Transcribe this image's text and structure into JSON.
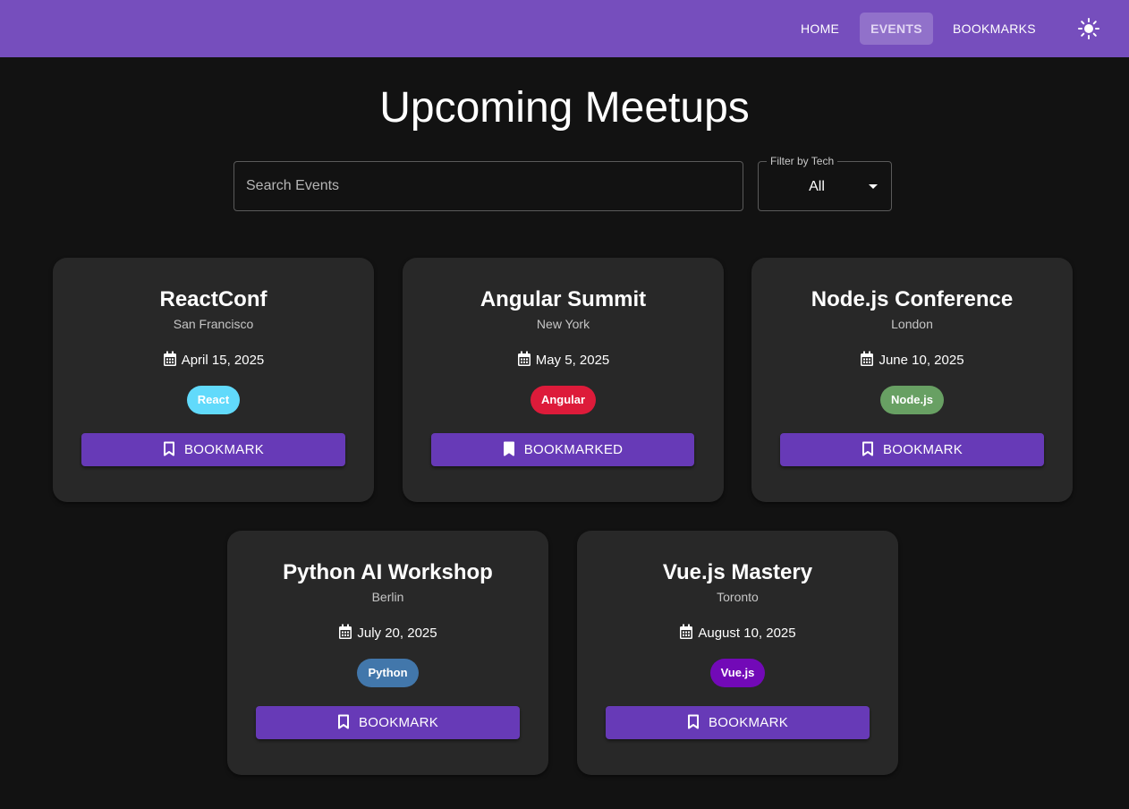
{
  "nav": {
    "home": "HOME",
    "events": "EVENTS",
    "bookmarks": "BOOKMARKS",
    "theme_icon": "sun-icon"
  },
  "page": {
    "title": "Upcoming Meetups"
  },
  "search": {
    "placeholder": "Search Events",
    "value": ""
  },
  "filter": {
    "label": "Filter by Tech",
    "selected": "All"
  },
  "colors": {
    "appbar": "#764ebd",
    "background": "#121212",
    "card": "#282828",
    "button": "#673ab7"
  },
  "events": [
    {
      "title": "ReactConf",
      "city": "San Francisco",
      "date": "April 15, 2025",
      "tag": "React",
      "tag_color": "#61dafb",
      "button": "BOOKMARK",
      "bookmarked": false
    },
    {
      "title": "Angular Summit",
      "city": "New York",
      "date": "May 5, 2025",
      "tag": "Angular",
      "tag_color": "#dd1b3a",
      "button": "BOOKMARKED",
      "bookmarked": true
    },
    {
      "title": "Node.js Conference",
      "city": "London",
      "date": "June 10, 2025",
      "tag": "Node.js",
      "tag_color": "#68a063",
      "button": "BOOKMARK",
      "bookmarked": false
    },
    {
      "title": "Python AI Workshop",
      "city": "Berlin",
      "date": "July 20, 2025",
      "tag": "Python",
      "tag_color": "#4277ab",
      "button": "BOOKMARK",
      "bookmarked": false
    },
    {
      "title": "Vue.js Mastery",
      "city": "Toronto",
      "date": "August 10, 2025",
      "tag": "Vue.js",
      "tag_color": "#7209b7",
      "button": "BOOKMARK",
      "bookmarked": false
    }
  ]
}
